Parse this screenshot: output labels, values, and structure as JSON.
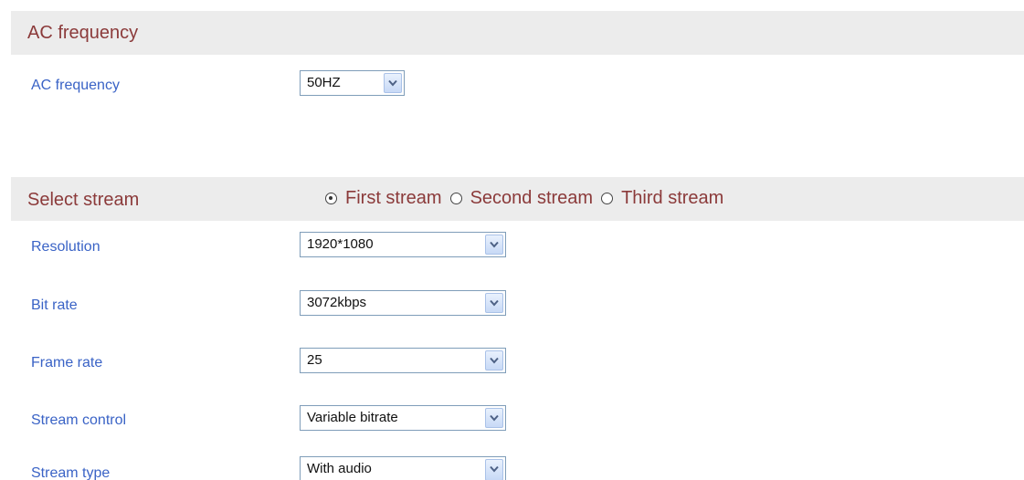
{
  "ac_section": {
    "title": "AC frequency",
    "field_label": "AC frequency",
    "field_value": "50HZ"
  },
  "stream_section": {
    "title": "Select stream",
    "options": [
      {
        "label": "First stream",
        "checked": true
      },
      {
        "label": "Second stream",
        "checked": false
      },
      {
        "label": "Third stream",
        "checked": false
      }
    ],
    "fields": [
      {
        "label": "Resolution",
        "value": "1920*1080"
      },
      {
        "label": "Bit rate",
        "value": "3072kbps"
      },
      {
        "label": "Frame rate",
        "value": "25"
      },
      {
        "label": "Stream control",
        "value": "Variable bitrate"
      },
      {
        "label": "Stream type",
        "value": "With audio"
      }
    ]
  },
  "colors": {
    "header_bg": "#ececec",
    "header_text": "#8b3a3a",
    "label_text": "#3a63c6",
    "select_border": "#7f9db9"
  }
}
